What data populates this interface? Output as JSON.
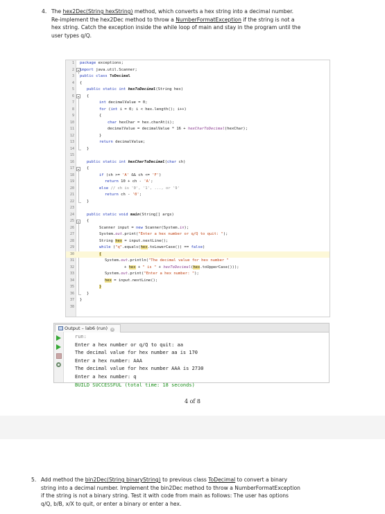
{
  "task4": {
    "number": "4.",
    "intro": "The ",
    "method_link": "hex2Dec(String hexString)",
    "rest1": " method, which converts a hex string into a decimal number.",
    "line2_pre": "Re-implement the hex2Dec method to throw a ",
    "exception_link": "NumberFormatException",
    "line2_post": " if the string is not a",
    "line3": "hex string. Catch the exception inside the while loop of main and stay in the program until the",
    "line4": "user types q/Q."
  },
  "code": {
    "line_numbers": [
      "1",
      "2",
      "3",
      "4",
      "5",
      "6",
      "7",
      "8",
      "9",
      "10",
      "11",
      "12",
      "13",
      "14",
      "15",
      "16",
      "17",
      "18",
      "19",
      "20",
      "21",
      "22",
      "23",
      "24",
      "25",
      "26",
      "27",
      "28",
      "29",
      "30",
      "31",
      "32",
      "33",
      "34",
      "35",
      "36",
      "37",
      "38"
    ]
  },
  "output": {
    "tab_title": "Output – lab6 (run)",
    "lines": [
      "run:",
      "Enter a hex number or q/Q to quit: aa",
      "The decimal value for hex number aa is 170",
      "Enter a hex number: AAA",
      "The decimal value for hex number AAA is 2730",
      "Enter a hex number: q",
      "BUILD SUCCESSFUL (total time: 18 seconds)"
    ]
  },
  "page_number": "4 of 8",
  "task5": {
    "number": "5.",
    "l1_pre": "Add method the ",
    "method_link": "bin2Dec(String binaryString)",
    "l1_mid": " to previous class ",
    "class_link": "ToDecimal",
    "l1_post": " to convert a binary",
    "line2": "string into a decimal number. Implement the bin2Dec method to throw a NumberFormatException",
    "line3": "if the string is not a binary string. Test it with code from main as follows: The user has options",
    "line4": "q/Q, b/B, x/X to quit, or enter a binary or enter a hex."
  }
}
